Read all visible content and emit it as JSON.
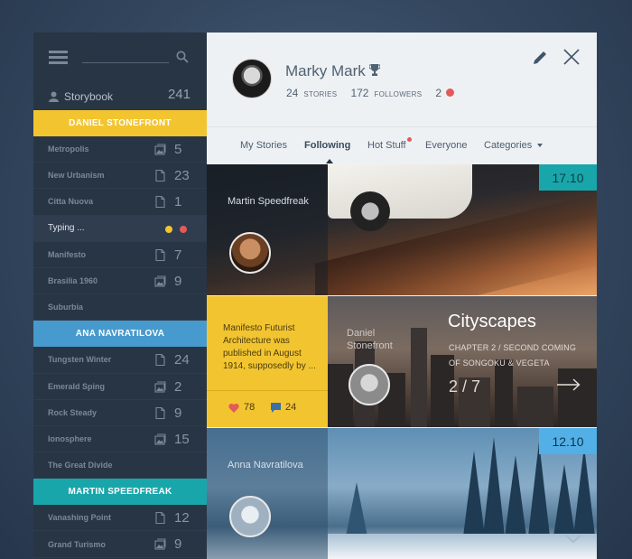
{
  "sidebar": {
    "search_placeholder": "",
    "storybook": {
      "label": "Storybook",
      "count": "241"
    },
    "groups": [
      {
        "title": "DANIEL STONEFRONT",
        "color": "#f2c530",
        "items": [
          {
            "name": "Metropolis",
            "icon": "image-stack-icon",
            "count": "5"
          },
          {
            "name": "New Urbanism",
            "icon": "document-icon",
            "count": "23"
          },
          {
            "name": "Citta Nuova",
            "icon": "document-icon",
            "count": "1"
          },
          {
            "name": "Typing ...",
            "active": true
          },
          {
            "name": "Manifesto",
            "icon": "document-icon",
            "count": "7"
          },
          {
            "name": "Brasilia 1960",
            "icon": "image-stack-icon",
            "count": "9"
          },
          {
            "name": "Suburbia"
          }
        ]
      },
      {
        "title": "ANA NAVRATILOVA",
        "color": "#479acd",
        "items": [
          {
            "name": "Tungsten Winter",
            "icon": "document-icon",
            "count": "24"
          },
          {
            "name": "Emerald Sping",
            "icon": "image-stack-icon",
            "count": "2"
          },
          {
            "name": "Rock Steady",
            "icon": "document-icon",
            "count": "9"
          },
          {
            "name": "Ionosphere",
            "icon": "image-stack-icon",
            "count": "15"
          },
          {
            "name": "The Great Divide"
          }
        ]
      },
      {
        "title": "MARTIN SPEEDFREAK",
        "color": "#19a6ab",
        "items": [
          {
            "name": "Vanashing Point",
            "icon": "document-icon",
            "count": "12"
          },
          {
            "name": "Grand Turismo",
            "icon": "image-stack-icon",
            "count": "9"
          }
        ]
      }
    ],
    "typing_dots": [
      "#f2c530",
      "#e35a5a"
    ]
  },
  "profile": {
    "name": "Marky Mark",
    "stories_count": "24",
    "stories_label": "STORIES",
    "followers_count": "172",
    "followers_label": "FOLLOWERS",
    "messages_count": "2"
  },
  "tabs": [
    {
      "label": "My Stories"
    },
    {
      "label": "Following",
      "active": true
    },
    {
      "label": "Hot Stuff",
      "has_dot": true
    },
    {
      "label": "Everyone"
    },
    {
      "label": "Categories",
      "dropdown": true
    }
  ],
  "feed": {
    "card1": {
      "author": "Martin Speedfreak",
      "date": "17.10"
    },
    "card2": {
      "summary": "Manifesto Futurist Architecture was published in August 1914, supposedly by ...",
      "likes": "78",
      "comments": "24",
      "author": "Daniel Stonefront",
      "title": "Cityscapes",
      "chapter": "CHAPTER 2 / SECOND COMING OF SONGOKU & VEGETA",
      "page": "2 / 7"
    },
    "card3": {
      "author": "Anna Navratilova",
      "date": "12.10"
    }
  },
  "colors": {
    "yellow": "#f2c530",
    "blue": "#479acd",
    "teal": "#19a6ab",
    "red": "#e35a5a"
  }
}
